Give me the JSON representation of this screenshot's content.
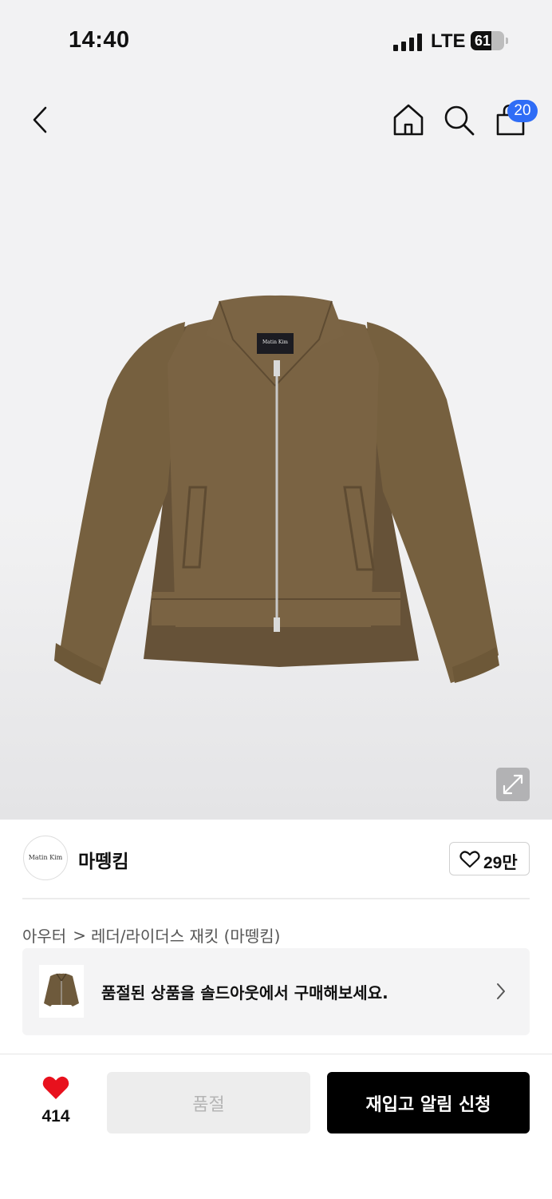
{
  "status_bar": {
    "time": "14:40",
    "network": "LTE",
    "battery": "61",
    "battery_level": 0.61
  },
  "header": {
    "icons": [
      "chevron-left-icon",
      "home-icon",
      "search-icon",
      "shopping-bag-icon"
    ],
    "cart_count": "20"
  },
  "product": {
    "image": "brown-suede-zip-jacket",
    "label_text": "Matin Kim",
    "expand_icon": "expand-icon"
  },
  "brand": {
    "logo_text": "Matin Kim",
    "name": "마뗑킴",
    "like_count": "29만"
  },
  "breadcrumb": {
    "category": "아우터",
    "separator": ">",
    "subcategory": "레더/라이더스 재킷 (마뗑킴)"
  },
  "soldout_banner": {
    "text": "품절된 상품을 솔드아웃에서 구매해보세요."
  },
  "bottom_bar": {
    "wish_count": "414",
    "soldout_label": "품절",
    "restock_label": "재입고 알림 신청"
  },
  "colors": {
    "badge": "#2f6df6",
    "heart": "#e8111d",
    "primary_button": "#000000"
  }
}
